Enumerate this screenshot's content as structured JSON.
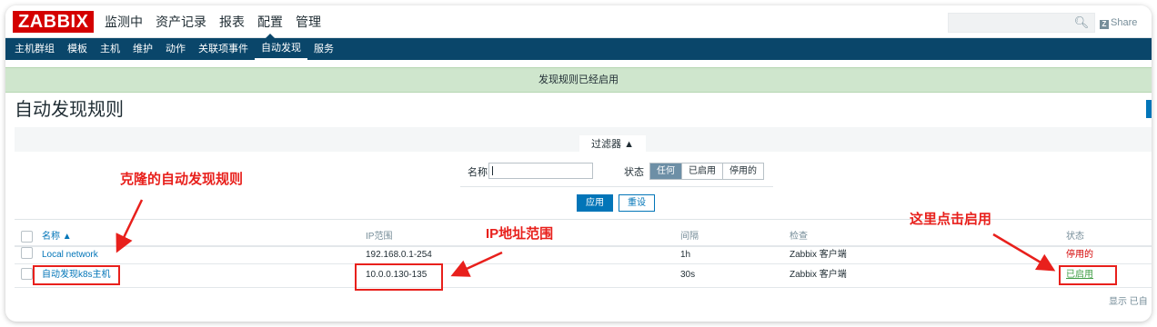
{
  "header": {
    "logo": "ZABBIX",
    "main_menu": [
      "监测中",
      "资产记录",
      "报表",
      "配置",
      "管理"
    ],
    "active_main": "配置",
    "share_label": "Share",
    "share_mark": "Z"
  },
  "sub_menu": [
    "主机群组",
    "模板",
    "主机",
    "维护",
    "动作",
    "关联项事件",
    "自动发现",
    "服务"
  ],
  "active_sub": "自动发现",
  "message": "发现规则已经启用",
  "page_title": "自动发现规则",
  "filter": {
    "tab_label": "过滤器 ▲",
    "name_label": "名称",
    "name_value": "",
    "status_label": "状态",
    "status_options": [
      "任何",
      "已启用",
      "停用的"
    ],
    "status_selected": "任何",
    "apply_label": "应用",
    "reset_label": "重设"
  },
  "table": {
    "columns": {
      "name": "名称 ▲",
      "ip_range": "IP范围",
      "interval": "间隔",
      "checks": "检查",
      "status": "状态"
    },
    "rows": [
      {
        "name": "Local network",
        "ip_range": "192.168.0.1-254",
        "interval": "1h",
        "checks": "Zabbix 客户端",
        "status": "停用的"
      },
      {
        "name": "自动发现k8s主机",
        "ip_range": "10.0.0.130-135",
        "interval": "30s",
        "checks": "Zabbix 客户端",
        "status": "已启用"
      }
    ],
    "footer": "显示 已自"
  },
  "annotations": {
    "cloned_rule": "克隆的自动发现规则",
    "ip_range": "IP地址范围",
    "click_enable": "这里点击启用"
  },
  "colors": {
    "brand_red": "#d40000",
    "nav_blue": "#0a466a",
    "link_blue": "#0275b8",
    "success_bg": "#cfe6cd",
    "enabled_green": "#429e47",
    "annotation_red": "#e8201c"
  }
}
